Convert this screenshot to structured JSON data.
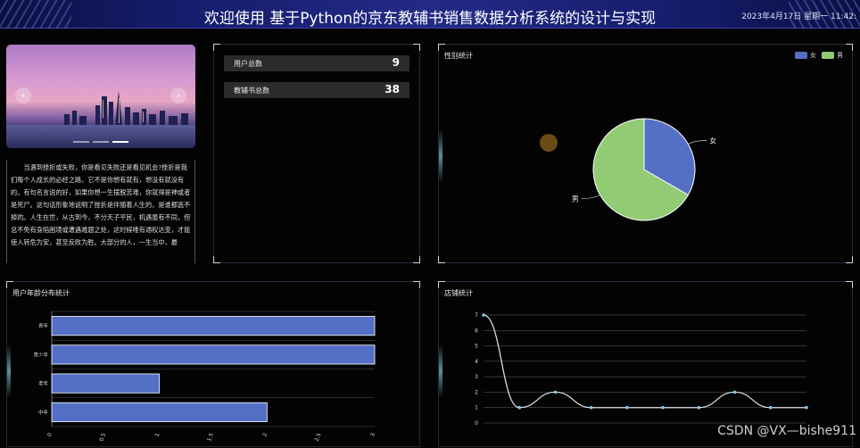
{
  "header": {
    "title": "欢迎使用 基于Python的京东教辅书销售数据分析系统的设计与实现",
    "clock": "2023年4月17日 星期一 11:42:"
  },
  "carousel": {
    "prev_icon": "‹",
    "next_icon": "›"
  },
  "essay": {
    "text": "当遇到挫折或失败，你是看见失败还是看见机会?挫折是我们每个人成长的必经之路，它不是你想有就有，想没有就没有的。有句名言说的好，如果你想一生摆脱苦难，你就得是神或者是死尸。这句话形象地说明了挫折是伴随着人生的，是谁都逃不掉的。人生在世，从古到今，不分天子平民，机遇虽有不同，但总不免有身陷困境或遭遇难题之处，这时候唯有通权达变，才能使人转危为安，甚至反败为胜。大部分的人，一生当中，最"
  },
  "stats": [
    {
      "label": "用户总数",
      "value": "9"
    },
    {
      "label": "教辅书总数",
      "value": "38"
    }
  ],
  "gender": {
    "title": "性别统计",
    "legend": [
      "女",
      "男"
    ],
    "labels": [
      "女",
      "男"
    ]
  },
  "age": {
    "title": "用户年龄分布统计"
  },
  "shop": {
    "title": "店铺统计"
  },
  "watermark": "CSDN @VX—bishe911",
  "colors": {
    "blue": "#5470c6",
    "green": "#91cc75",
    "bar": "#5470c6"
  },
  "chart_data": [
    {
      "type": "pie",
      "title": "性别统计",
      "categories": [
        "女",
        "男"
      ],
      "values": [
        3,
        6
      ]
    },
    {
      "type": "bar",
      "orientation": "horizontal",
      "title": "用户年龄分布统计",
      "categories": [
        "中年",
        "老年",
        "青少年",
        "青年"
      ],
      "values": [
        2,
        1,
        3,
        3
      ],
      "xlim": [
        0,
        3
      ],
      "xticks": [
        "0",
        "0.5",
        "1",
        "1.5",
        "2",
        "2.5",
        "3"
      ]
    },
    {
      "type": "line",
      "title": "店铺统计",
      "x": [
        "",
        "",
        "",
        "",
        "",
        "",
        "",
        "",
        ""
      ],
      "values": [
        7,
        1,
        2,
        1,
        1,
        1,
        1,
        2,
        1,
        1
      ],
      "ylim": [
        0,
        7
      ],
      "yticks": [
        "0",
        "1",
        "2",
        "3",
        "4",
        "5",
        "6",
        "7"
      ]
    }
  ]
}
